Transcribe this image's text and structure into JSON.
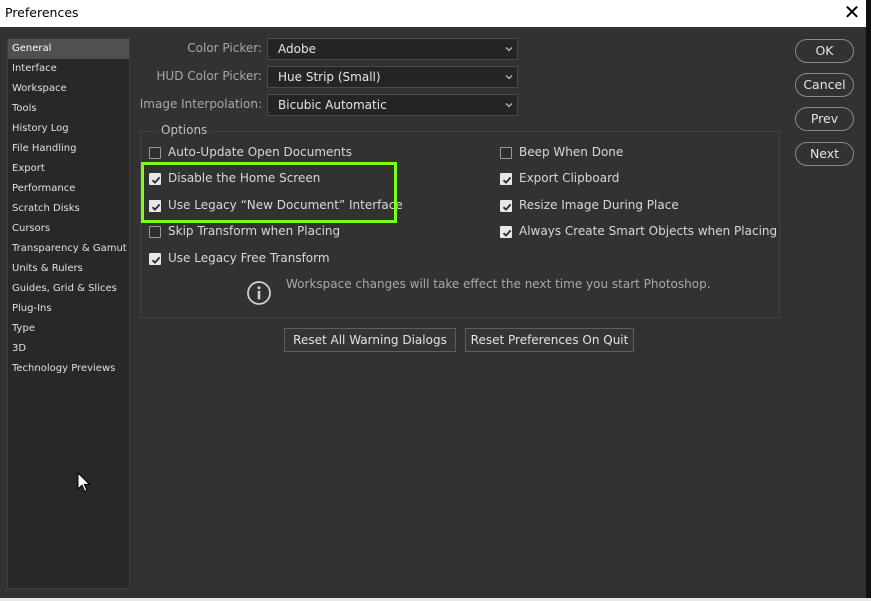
{
  "window": {
    "title": "Preferences",
    "close_glyph": "✕"
  },
  "sidebar": {
    "items": [
      {
        "label": "General",
        "selected": true
      },
      {
        "label": "Interface"
      },
      {
        "label": "Workspace"
      },
      {
        "label": "Tools"
      },
      {
        "label": "History Log"
      },
      {
        "label": "File Handling"
      },
      {
        "label": "Export"
      },
      {
        "label": "Performance"
      },
      {
        "label": "Scratch Disks"
      },
      {
        "label": "Cursors"
      },
      {
        "label": "Transparency & Gamut"
      },
      {
        "label": "Units & Rulers"
      },
      {
        "label": "Guides, Grid & Slices"
      },
      {
        "label": "Plug-Ins"
      },
      {
        "label": "Type"
      },
      {
        "label": "3D"
      },
      {
        "label": "Technology Previews"
      }
    ]
  },
  "fields": {
    "color_picker": {
      "label": "Color Picker:",
      "value": "Adobe"
    },
    "hud_color_picker": {
      "label": "HUD Color Picker:",
      "value": "Hue Strip (Small)"
    },
    "image_interpolation": {
      "label": "Image Interpolation:",
      "value": "Bicubic Automatic"
    }
  },
  "options": {
    "title": "Options",
    "left": [
      {
        "label": "Auto-Update Open Documents",
        "checked": false
      },
      {
        "label": "Disable the Home Screen",
        "checked": true
      },
      {
        "label": "Use Legacy “New Document” Interface",
        "checked": true
      },
      {
        "label": "Skip Transform when Placing",
        "checked": false
      },
      {
        "label": "Use Legacy Free Transform",
        "checked": true
      }
    ],
    "right": [
      {
        "label": "Beep When Done",
        "checked": false
      },
      {
        "label": "Export Clipboard",
        "checked": true
      },
      {
        "label": "Resize Image During Place",
        "checked": true
      },
      {
        "label": "Always Create Smart Objects when Placing",
        "checked": true
      }
    ],
    "info_text": "Workspace changes will take effect the next time you start Photoshop."
  },
  "buttons": {
    "reset_warnings": "Reset All Warning Dialogs",
    "reset_prefs": "Reset Preferences On Quit",
    "ok": "OK",
    "cancel": "Cancel",
    "prev": "Prev",
    "next": "Next"
  },
  "colors": {
    "highlight": "#7dff1a",
    "background": "#323232",
    "sidebar_selected": "#505050"
  },
  "icons": {
    "info": "info-icon",
    "close": "close-icon",
    "chevron": "chevron-down-icon",
    "checkmark": "checkmark-icon",
    "cursor": "mouse-pointer-icon"
  }
}
